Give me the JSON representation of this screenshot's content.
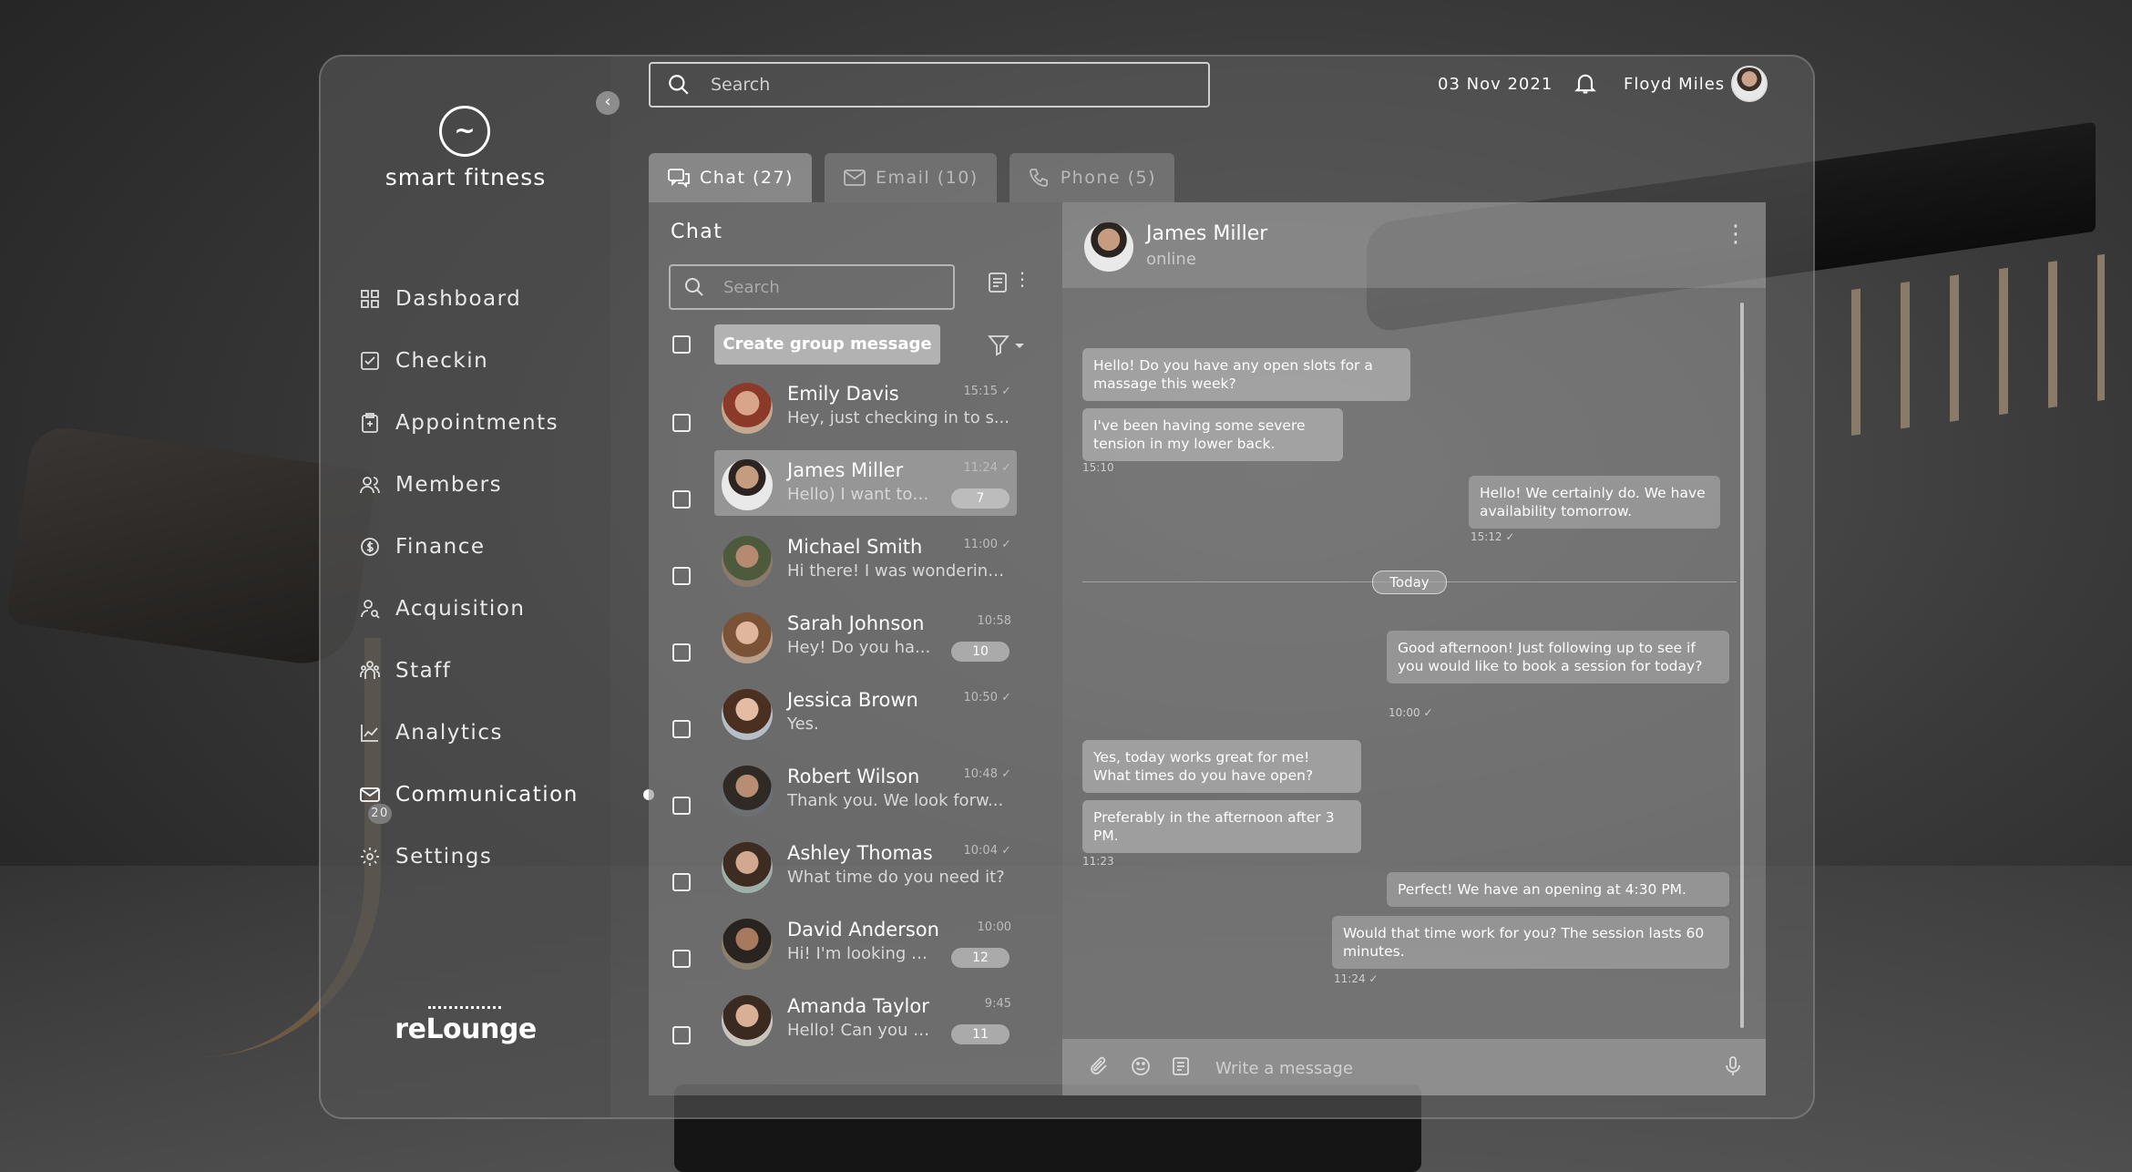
{
  "sidebar": {
    "brand": "smart fitness",
    "items": [
      {
        "label": "Dashboard",
        "icon": "grid-icon"
      },
      {
        "label": "Checkin",
        "icon": "checkbox-icon"
      },
      {
        "label": "Appointments",
        "icon": "clipboard-icon"
      },
      {
        "label": "Members",
        "icon": "members-icon"
      },
      {
        "label": "Finance",
        "icon": "coin-icon"
      },
      {
        "label": "Acquisition",
        "icon": "user-search-icon"
      },
      {
        "label": "Staff",
        "icon": "staff-icon"
      },
      {
        "label": "Analytics",
        "icon": "chart-icon"
      },
      {
        "label": "Communication",
        "icon": "mail-icon",
        "badge": "20"
      },
      {
        "label": "Settings",
        "icon": "gear-icon"
      }
    ],
    "footer_logo": "reLounge"
  },
  "header": {
    "search_placeholder": "Search",
    "date": "03 Nov 2021",
    "user_name": "Floyd Miles"
  },
  "tabs": [
    {
      "label": "Chat (27)",
      "icon": "chat-icon"
    },
    {
      "label": "Email (10)",
      "icon": "envelope-icon"
    },
    {
      "label": "Phone (5)",
      "icon": "phone-icon"
    }
  ],
  "chat_list": {
    "title": "Chat",
    "search_placeholder": "Search",
    "group_button": "Create group message",
    "conversations": [
      {
        "name": "Emily Davis",
        "preview": "Hey, just checking in to s...",
        "time": "15:15",
        "read": true,
        "badge": ""
      },
      {
        "name": "James Miller",
        "preview": "Hello) I want to ...",
        "time": "11:24",
        "read": true,
        "badge": "7"
      },
      {
        "name": "Michael Smith",
        "preview": "Hi there! I was wondering...",
        "time": "11:00",
        "read": true,
        "badge": ""
      },
      {
        "name": "Sarah Johnson",
        "preview": "Hey! Do you ha...",
        "time": "10:58",
        "read": false,
        "badge": "10"
      },
      {
        "name": "Jessica Brown",
        "preview": "Yes.",
        "time": "10:50",
        "read": true,
        "badge": ""
      },
      {
        "name": "Robert Wilson",
        "preview": "Thank you. We look forw...",
        "time": "10:48",
        "read": true,
        "badge": ""
      },
      {
        "name": "Ashley Thomas",
        "preview": "What time do you need it?",
        "time": "10:04",
        "read": true,
        "badge": ""
      },
      {
        "name": "David Anderson",
        "preview": "Hi! I'm looking t...",
        "time": "10:00",
        "read": false,
        "badge": "12"
      },
      {
        "name": "Amanda Taylor",
        "preview": "Hello! Can you l...",
        "time": "9:45",
        "read": false,
        "badge": "11"
      }
    ]
  },
  "conversation": {
    "name": "James Miller",
    "status": "online",
    "divider_label": "Today",
    "composer_placeholder": "Write a message",
    "messages": [
      {
        "dir": "in",
        "text": "Hello! Do you have any open slots for a massage this week?"
      },
      {
        "dir": "in",
        "text": "I've been having some severe tension in my lower back.",
        "time": "15:10"
      },
      {
        "dir": "out",
        "text": "Hello! We certainly do. We have availability tomorrow.",
        "time": "15:12 ✓"
      },
      {
        "dir": "out",
        "text": "Good afternoon! Just following up to see if you would like to book a session for today?",
        "time": "10:00 ✓"
      },
      {
        "dir": "in",
        "text": "Yes, today works great for me! What times do you have open?"
      },
      {
        "dir": "in",
        "text": "Preferably in the afternoon after 3 PM.",
        "time": "11:23"
      },
      {
        "dir": "out",
        "text": "Perfect! We have an opening at 4:30 PM."
      },
      {
        "dir": "out",
        "text": "Would that time work for you? The session lasts 60 minutes.",
        "time": "11:24 ✓"
      }
    ]
  },
  "colors": {
    "panel": "#5f5f5f",
    "text": "#ffffff",
    "muted": "#c9c9c9"
  }
}
